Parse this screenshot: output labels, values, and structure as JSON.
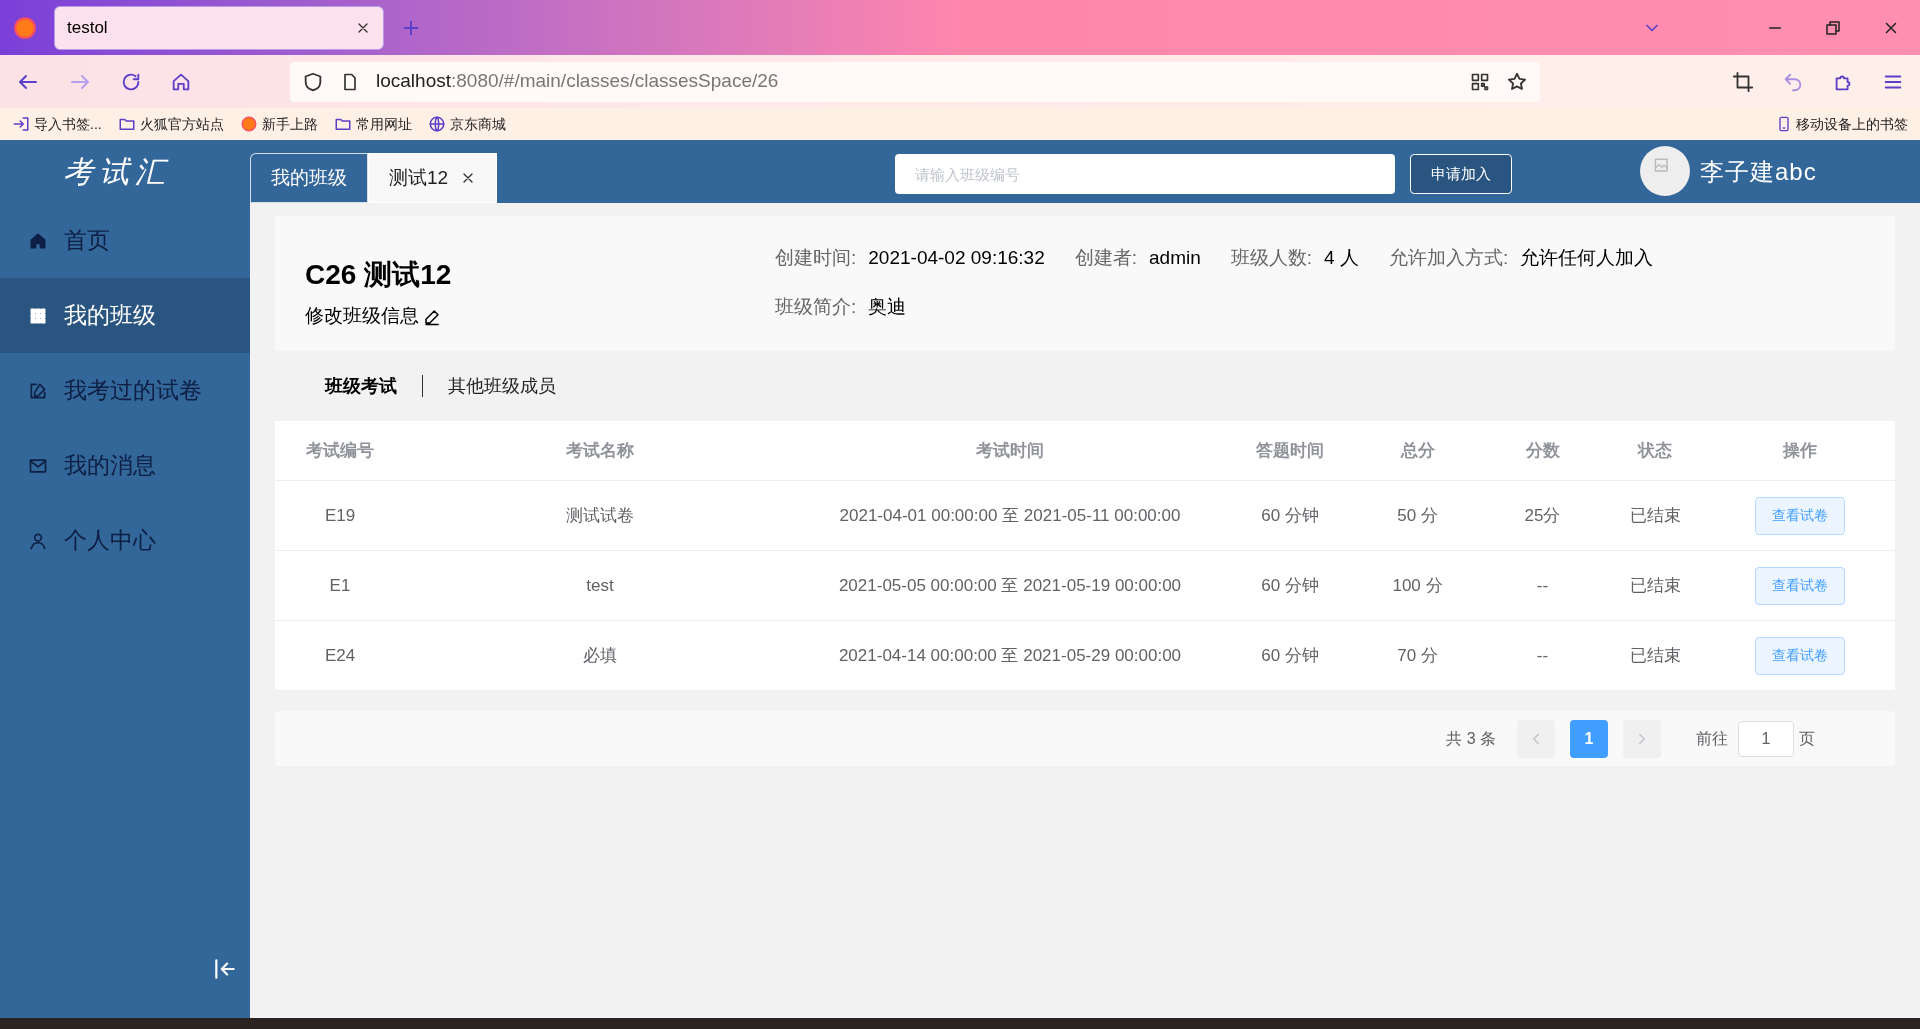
{
  "browser": {
    "tabs": [
      {
        "title": "testol",
        "selected": true
      }
    ],
    "url_host": "localhost",
    "url_rest": ":8080/#/main/classes/classesSpace/26",
    "bookmarks": [
      {
        "kind": "import",
        "label": "导入书签..."
      },
      {
        "kind": "folder",
        "label": "火狐官方站点"
      },
      {
        "kind": "firefox",
        "label": "新手上路"
      },
      {
        "kind": "folder",
        "label": "常用网址"
      },
      {
        "kind": "globe",
        "label": "京东商城"
      }
    ],
    "mobile_bookmarks": "移动设备上的书签"
  },
  "app": {
    "logo": "考试汇",
    "sidebar": [
      {
        "kind": "home",
        "label": "首页",
        "selected": false
      },
      {
        "kind": "grid",
        "label": "我的班级",
        "selected": true
      },
      {
        "kind": "edit",
        "label": "我考过的试卷",
        "selected": false
      },
      {
        "kind": "mail",
        "label": "我的消息",
        "selected": false
      },
      {
        "kind": "user",
        "label": "个人中心",
        "selected": false
      }
    ],
    "tabs": [
      {
        "label": "我的班级",
        "selected": false,
        "closable": false
      },
      {
        "label": "测试12",
        "selected": true,
        "closable": true
      }
    ],
    "search": {
      "placeholder": "请输入班级编号"
    },
    "join_button": "申请加入",
    "user_name": "李子建abc",
    "class_info": {
      "title": "C26 测试12",
      "edit_link": "修改班级信息",
      "fields": [
        {
          "label": "创建时间:",
          "value": "2021-04-02 09:16:32"
        },
        {
          "label": "创建者:",
          "value": "admin"
        },
        {
          "label": "班级人数:",
          "value": "4 人"
        },
        {
          "label": "允许加入方式:",
          "value": "允许任何人加入"
        },
        {
          "label": "班级简介:",
          "value": "奥迪"
        }
      ]
    },
    "section_tabs": [
      {
        "label": "班级考试",
        "selected": true
      },
      {
        "label": "其他班级成员",
        "selected": false
      }
    ],
    "table": {
      "columns": [
        "考试编号",
        "考试名称",
        "考试时间",
        "答题时间",
        "总分",
        "分数",
        "状态",
        "操作"
      ],
      "rows": [
        [
          "E19",
          "测试试卷",
          "2021-04-01 00:00:00 至 2021-05-11 00:00:00",
          "60 分钟",
          "50 分",
          "25分",
          "已结束",
          "查看试卷"
        ],
        [
          "E1",
          "test",
          "2021-05-05 00:00:00 至 2021-05-19 00:00:00",
          "60 分钟",
          "100 分",
          "--",
          "已结束",
          "查看试卷"
        ],
        [
          "E24",
          "必填",
          "2021-04-14 00:00:00 至 2021-05-29 00:00:00",
          "60 分钟",
          "70 分",
          "--",
          "已结束",
          "查看试卷"
        ]
      ]
    },
    "pagination": {
      "total": "共 3 条",
      "pages": [
        {
          "label": "1",
          "selected": true
        }
      ],
      "goto_label": "前往",
      "goto_value": "1",
      "page_suffix": "页"
    }
  }
}
